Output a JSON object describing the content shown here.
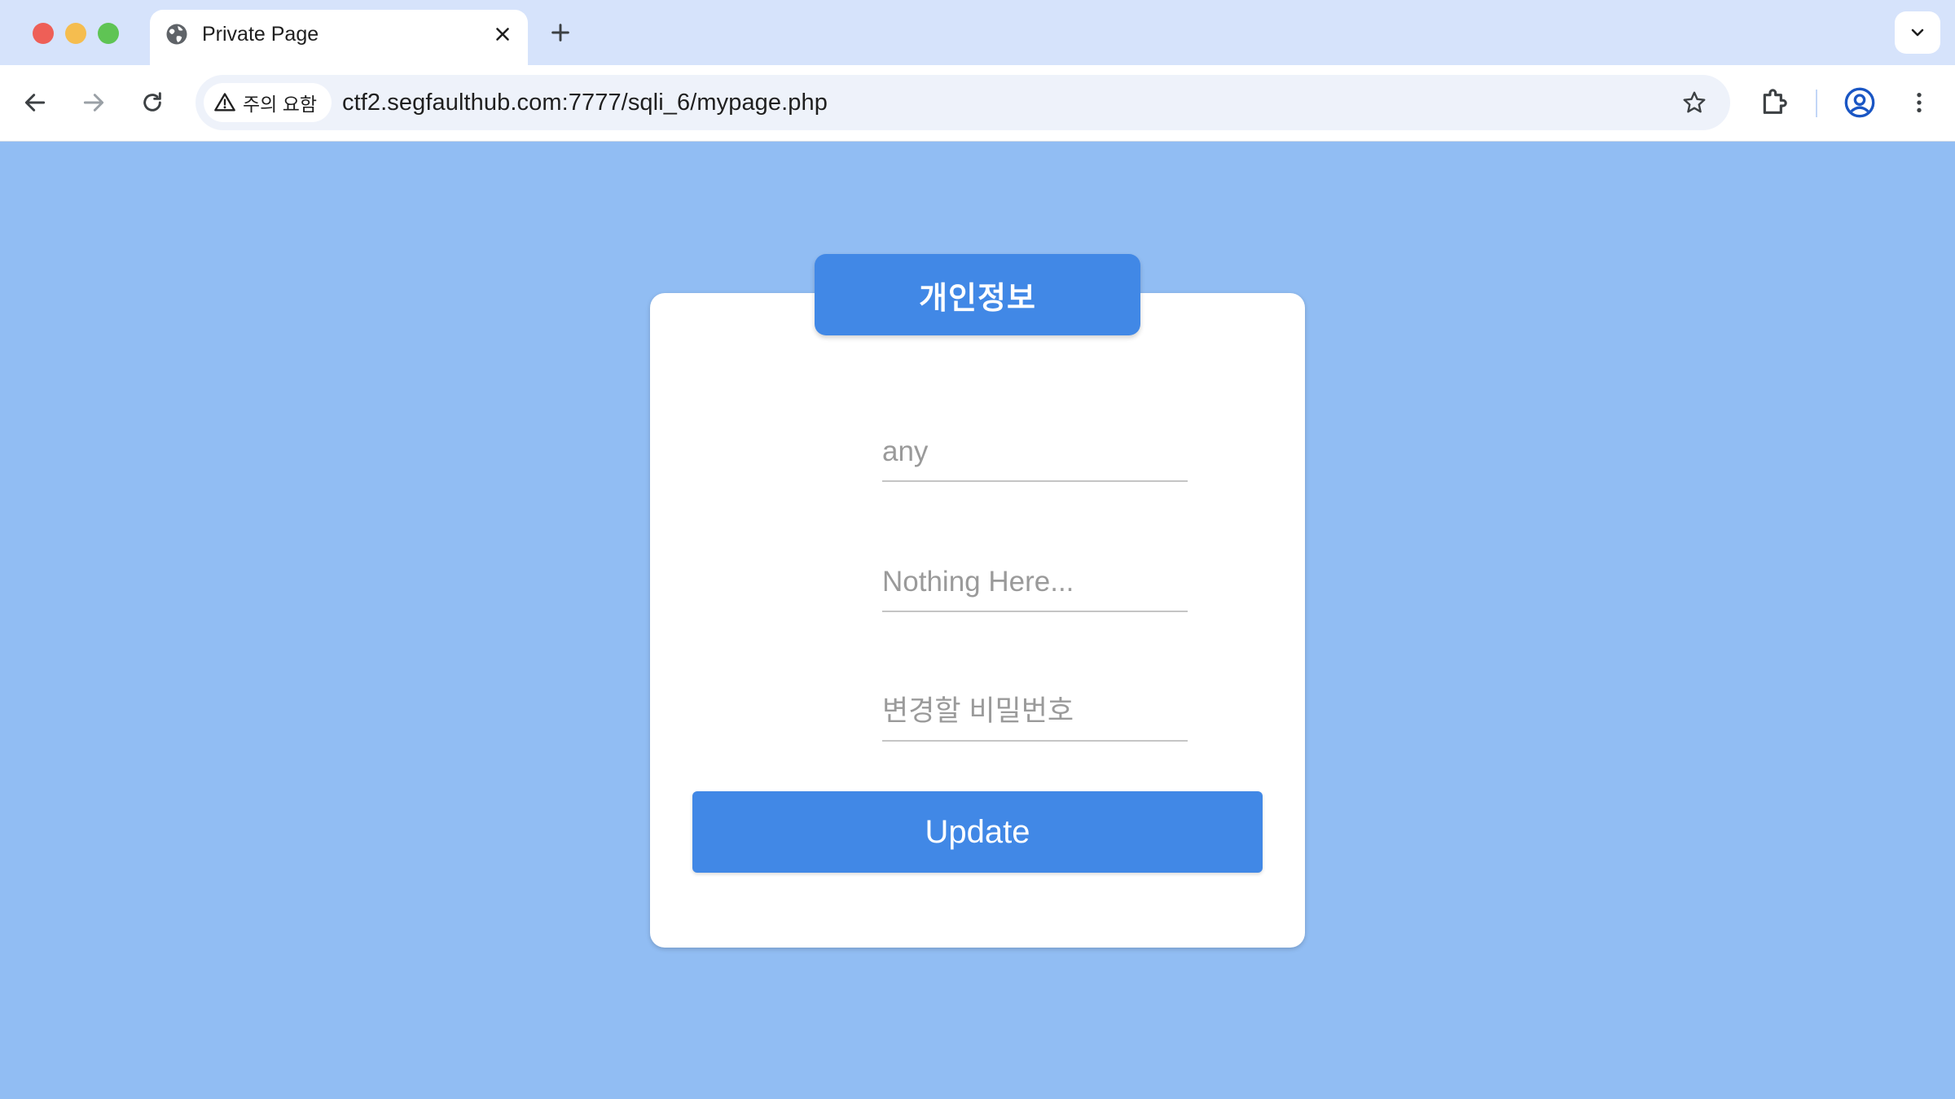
{
  "browser": {
    "tab": {
      "title": "Private Page"
    },
    "address_bar": {
      "security_label": "주의 요함",
      "url": "ctf2.segfaulthub.com:7777/sqli_6/mypage.php"
    },
    "icons": {
      "tab": "globe-icon",
      "close": "close-icon",
      "new_tab": "plus-icon",
      "tab_menu": "chevron-down-icon",
      "back": "arrow-left-icon",
      "forward": "arrow-right-icon",
      "reload": "reload-icon",
      "security": "warning-triangle-icon",
      "bookmark": "star-icon",
      "extensions": "puzzle-icon",
      "profile": "profile-icon",
      "menu": "kebab-menu-icon"
    }
  },
  "form": {
    "title": "개인정보",
    "fields": [
      {
        "placeholder": "any",
        "value": ""
      },
      {
        "placeholder": "Nothing Here...",
        "value": ""
      },
      {
        "placeholder": "변경할 비밀번호",
        "value": ""
      }
    ],
    "submit_label": "Update"
  },
  "colors": {
    "page_background": "#91bdf3",
    "accent": "#4188e6",
    "tabstrip": "#d6e3fb",
    "omnibox": "#eef2fa"
  }
}
